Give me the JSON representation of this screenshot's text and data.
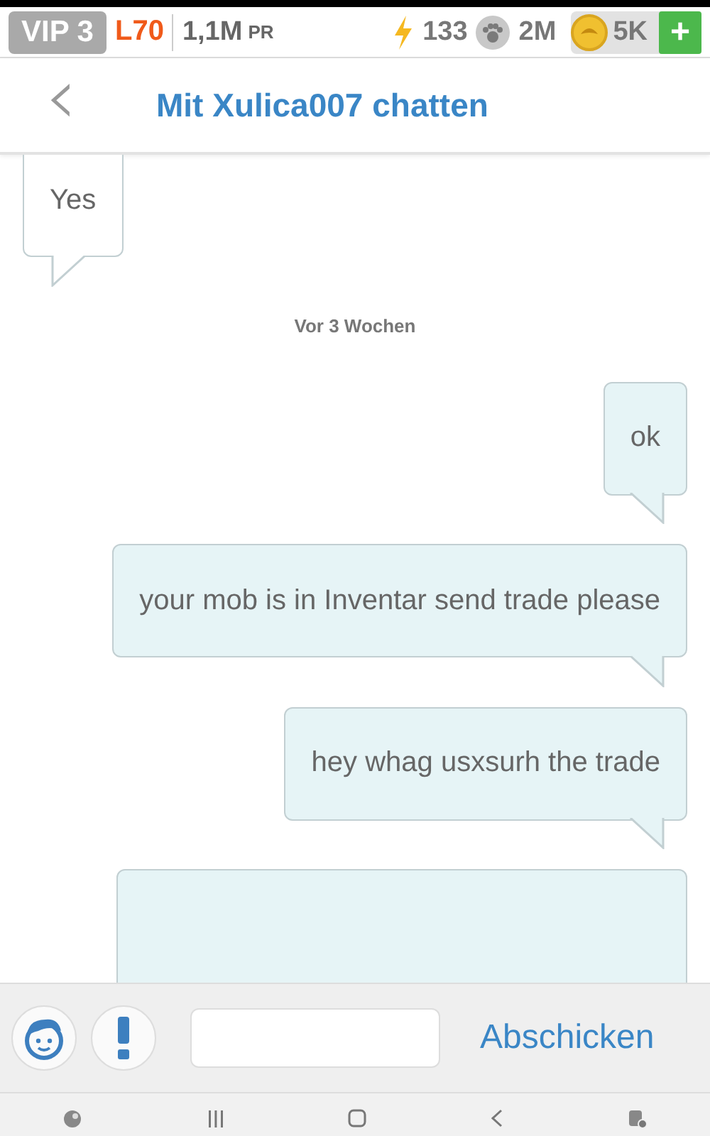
{
  "status_bar": {
    "vip": "VIP 3",
    "level": "L70",
    "power": "1,1M",
    "power_unit": "PR",
    "energy": "133",
    "paws": "2M",
    "coins": "5K",
    "add": "+"
  },
  "header": {
    "back": "‹",
    "title": "Mit Xulica007 chatten"
  },
  "messages": [
    {
      "kind": "in",
      "text": "Yes"
    },
    {
      "kind": "time",
      "text": "Vor 3 Wochen"
    },
    {
      "kind": "out",
      "text": "ok"
    },
    {
      "kind": "out",
      "text": "your mob is in Inventar send trade please"
    },
    {
      "kind": "out",
      "text": "hey whag usxsurh the trade"
    },
    {
      "kind": "out_cut"
    }
  ],
  "composer": {
    "send": "Abschicken"
  }
}
